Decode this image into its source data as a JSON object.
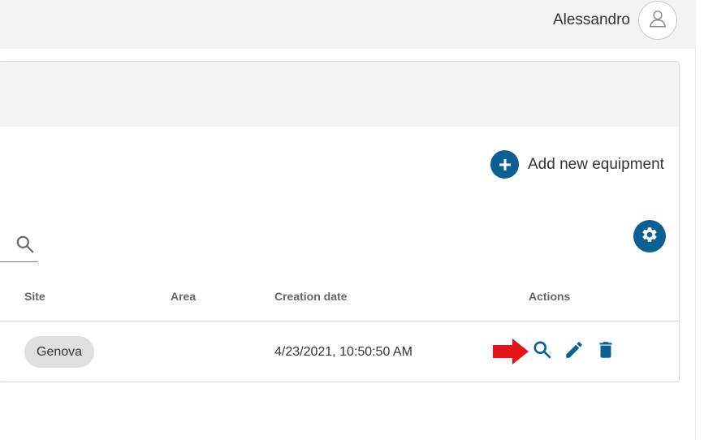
{
  "user": {
    "name": "Alessandro",
    "avatar_icon": "user-icon"
  },
  "toolbar": {
    "add_label": "Add new equipment",
    "add_icon": "plus-icon",
    "settings_icon": "gear-icon"
  },
  "search": {
    "icon": "search-icon",
    "value": ""
  },
  "table": {
    "headers": {
      "site": "Site",
      "area": "Area",
      "creation_date": "Creation date",
      "actions": "Actions"
    },
    "rows": [
      {
        "site": "Genova",
        "area": "",
        "creation_date": "4/23/2021, 10:50:50 AM",
        "actions": [
          "search-icon",
          "edit-icon",
          "delete-icon"
        ]
      }
    ]
  },
  "colors": {
    "accent": "#0b5f91",
    "highlight_arrow": "#e5141b",
    "header_bg": "#f3f3f3"
  }
}
